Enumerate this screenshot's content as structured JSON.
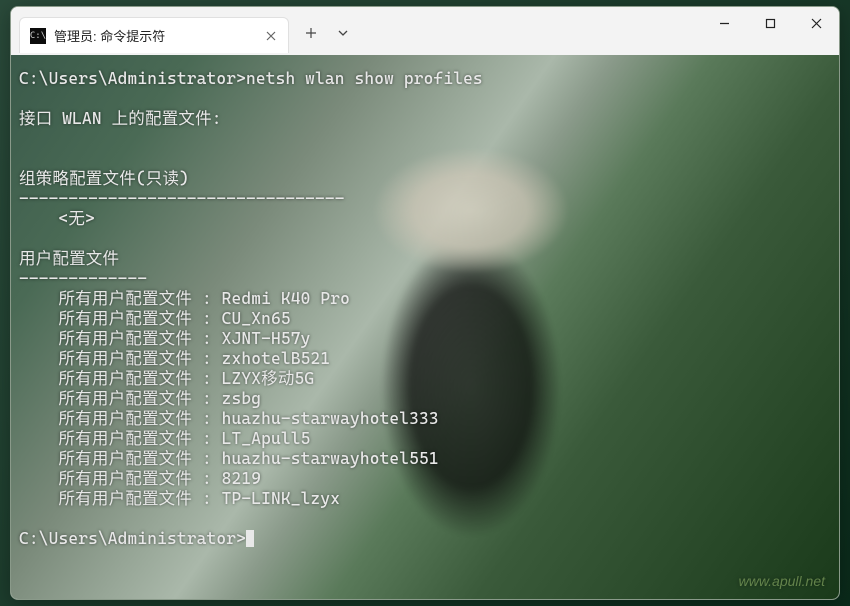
{
  "window": {
    "tab_title": "管理员: 命令提示符",
    "tab_icon_text": "C:\\"
  },
  "terminal": {
    "prompt": "C:\\Users\\Administrator>",
    "command": "netsh wlan show profiles",
    "section_interface": "接口 WLAN 上的配置文件:",
    "section_group_policy": "组策略配置文件(只读)",
    "group_policy_divider": "---------------------------------",
    "group_policy_none": "    <无>",
    "section_user": "用户配置文件",
    "user_divider": "-------------",
    "profile_label": "    所有用户配置文件 : ",
    "profiles": [
      "Redmi K40 Pro",
      "CU_Xn65",
      "XJNT-H57y",
      "zxhotelB521",
      "LZYX移动5G",
      "zsbg",
      "huazhu-starwayhotel333",
      "LT_Apull5",
      "huazhu-starwayhotel551",
      "8219",
      "TP-LINK_lzyx"
    ],
    "final_prompt": "C:\\Users\\Administrator>"
  },
  "watermark": "www.apull.net"
}
